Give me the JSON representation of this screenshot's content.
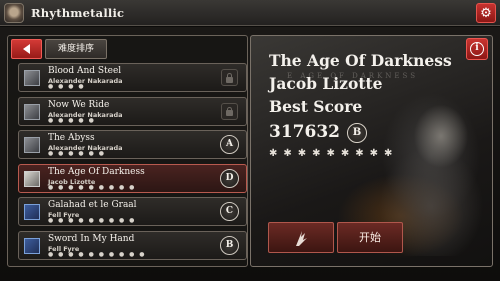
{
  "app": {
    "title": "Rhythmetallic"
  },
  "toolbar": {
    "sort_label": "难度排序"
  },
  "songs": [
    {
      "name": "Blood And Steel",
      "artist": "Alexander Nakarada",
      "stars": "● ● ● ●",
      "status": "locked",
      "grade": ""
    },
    {
      "name": "Now We Ride",
      "artist": "Alexander Nakarada",
      "stars": "● ● ● ● ●",
      "status": "locked",
      "grade": ""
    },
    {
      "name": "The Abyss",
      "artist": "Alexander Nakarada",
      "stars": "● ● ● ● ● ●",
      "status": "unlocked",
      "grade": "A"
    },
    {
      "name": "The Age Of Darkness",
      "artist": "Jacob Lizotte",
      "stars": "● ● ● ● ● ● ● ● ●",
      "status": "selected",
      "grade": "D"
    },
    {
      "name": "Galahad et le Graal",
      "artist": "Fell Fyre",
      "stars": "● ● ● ● ● ● ● ● ●",
      "status": "unlocked",
      "grade": "C"
    },
    {
      "name": "Sword In My Hand",
      "artist": "Fell Fyre",
      "stars": "● ● ● ● ● ● ● ● ● ●",
      "status": "unlocked",
      "grade": "B"
    }
  ],
  "detail": {
    "title": "The Age Of Darkness",
    "artist": "Jacob Lizotte",
    "best_label": "Best Score",
    "score": "317632",
    "grade": "B",
    "stars": "✱✱✱✱✱✱✱✱✱",
    "watermark": "E   AGE  OF   DARKNESS"
  },
  "actions": {
    "start_label": "开始"
  },
  "colors": {
    "accent_red": "#c93531",
    "selected_row": "#4a2320"
  }
}
